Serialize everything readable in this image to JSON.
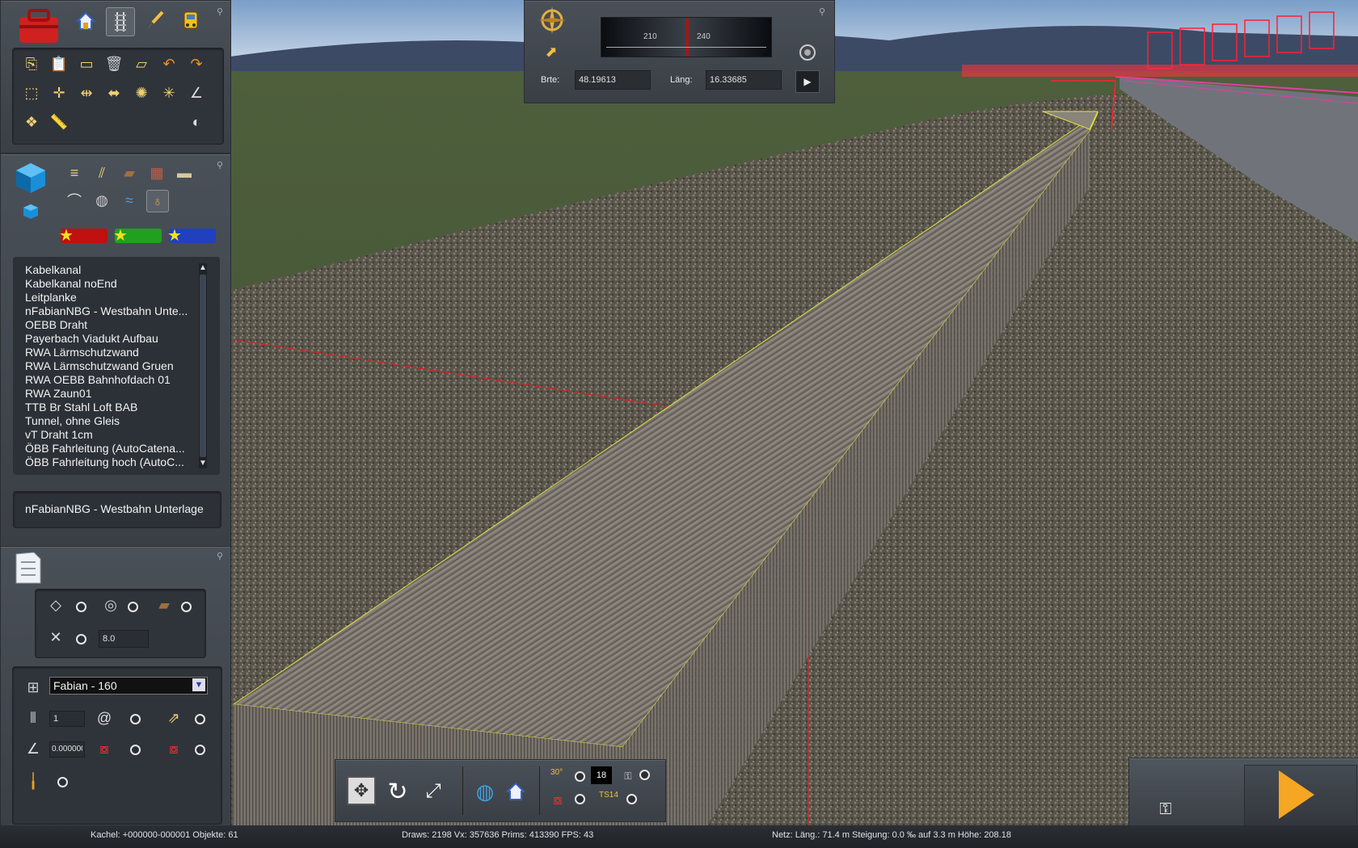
{
  "compass": {
    "gauge_ticks": [
      "210",
      "240"
    ],
    "lat_label": "Brte:",
    "lat_value": "48.19613",
    "lon_label": "Läng:",
    "lon_value": "16.33685"
  },
  "object_list": {
    "items": [
      "Kabelkanal",
      "Kabelkanal noEnd",
      "Leitplanke",
      "nFabianNBG - Westbahn Unte...",
      "OEBB Draht",
      "Payerbach Viadukt Aufbau",
      "RWA Lärmschutzwand",
      "RWA Lärmschutzwand Gruen",
      "RWA OEBB Bahnhofdach 01",
      "RWA Zaun01",
      "TTB Br Stahl Loft BAB",
      "Tunnel, ohne Gleis",
      "vT Draht 1cm",
      "ÖBB Fahrleitung (AutoCatena...",
      "ÖBB Fahrleitung hoch (AutoC..."
    ],
    "selected": "nFabianNBG - Westbahn Unterlage"
  },
  "properties": {
    "spacing_value": "8.0"
  },
  "track_tools": {
    "track_type": "Fabian - 160",
    "count_value": "1",
    "gradient_value": "0.000000"
  },
  "bottom_toolbar": {
    "counter_value": "18",
    "label_30": "30°",
    "label_ts14": "TS14"
  },
  "status_bar": {
    "tile": "Kachel: +000000-000001  Objekte: 61",
    "stats": "Draws: 2198 Vx: 357636 Prims: 413390 FPS: 43",
    "network": "Netz:  Läng.:   71.4 m Steigung:  0.0 ‰ auf  3.3 m Höhe: 208.18"
  },
  "icons": [
    "toolbox-icon",
    "home-icon",
    "track-tool-icon",
    "paint-brush-icon",
    "train-icon",
    "compass-icon",
    "play-icon",
    "lock-icon"
  ],
  "colors": {
    "panel": "#3f444b",
    "accent_red": "#c01010",
    "accent_green": "#20a020",
    "accent_blue": "#2040c0",
    "play": "#f5a623"
  }
}
